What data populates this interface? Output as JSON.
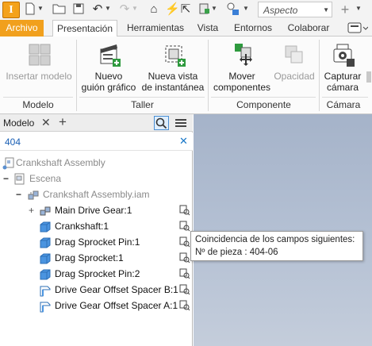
{
  "app": {
    "logo_letter": "I"
  },
  "quick_access": {
    "aspect_placeholder": "Aspecto",
    "icons": [
      "new-icon",
      "open-icon",
      "save-icon",
      "undo-icon",
      "redo-icon",
      "home-icon",
      "update-icon",
      "select-icon",
      "material-icon",
      "appearance-icon",
      "add-icon"
    ]
  },
  "tabs": [
    {
      "label": "Archivo"
    },
    {
      "label": "Presentación",
      "active": true
    },
    {
      "label": "Herramientas"
    },
    {
      "label": "Vista"
    },
    {
      "label": "Entornos"
    },
    {
      "label": "Colaborar"
    }
  ],
  "ribbon": {
    "insert_model": "Insertar modelo",
    "new_storyboard": [
      "Nuevo",
      "guión gráfico"
    ],
    "new_snapshot": [
      "Nueva vista",
      "de instantánea"
    ],
    "move_components": [
      "Mover",
      "componentes"
    ],
    "opacity": "Opacidad",
    "capture_camera": [
      "Capturar",
      "cámara"
    ],
    "groups": {
      "model": "Modelo",
      "workshop": "Taller",
      "component": "Componente",
      "camera": "Cámara"
    }
  },
  "browser": {
    "title": "Modelo",
    "search_value": "404",
    "tree": [
      {
        "label": "Crankshaft Assembly",
        "muted": true
      },
      {
        "label": "Escena",
        "muted": true
      },
      {
        "label": "Crankshaft Assembly.iam",
        "muted": true
      },
      {
        "label": "Main Drive Gear:1"
      },
      {
        "label": "Crankshaft:1"
      },
      {
        "label": "Drag Sprocket Pin:1"
      },
      {
        "label": "Drag Sprocket:1"
      },
      {
        "label": "Drag Sprocket Pin:2"
      },
      {
        "label": "Drive Gear Offset Spacer B:1"
      },
      {
        "label": "Drive Gear Offset Spacer A:1"
      }
    ]
  },
  "tooltip": {
    "line1": "Coincidencia de los campos siguientes:",
    "line2": "Nº de pieza : 404-06"
  },
  "colors": {
    "accent": "#f1a01d",
    "search_text": "#1a5fb4",
    "viewport": "#b0bdd0"
  }
}
